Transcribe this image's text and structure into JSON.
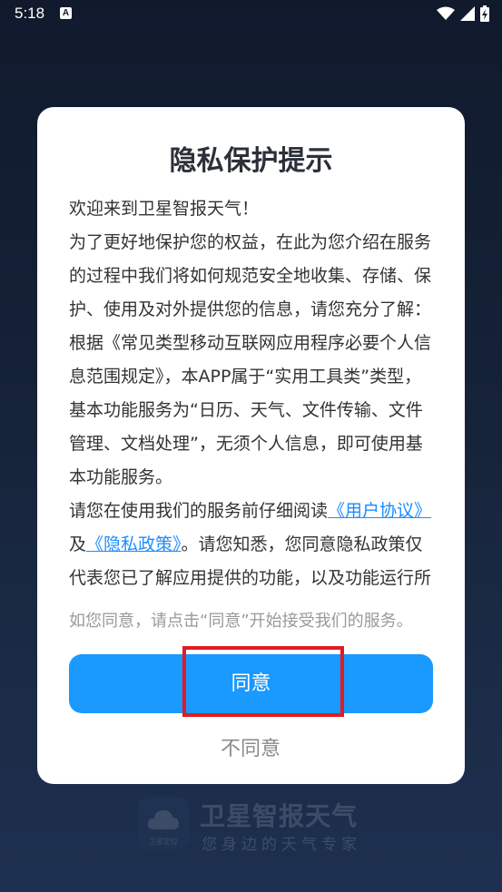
{
  "status_bar": {
    "time": "5:18",
    "notification_icon_letter": "A",
    "icons": [
      "wifi-icon",
      "signal-icon",
      "battery-charging-icon"
    ]
  },
  "dialog": {
    "title": "隐私保护提示",
    "paragraphs": {
      "p1": "欢迎来到卫星智报天气！",
      "p2": "为了更好地保护您的权益，在此为您介绍在服务的过程中我们将如何规范安全地收集、存储、保护、使用及对外提供您的信息，请您充分了解：根据《常见类型移动互联网应用程序必要个人信息范围规定》，本APP属于“实用工具类”类型，基本功能服务为“日历、天气、文件传输、文件管理、文档处理”，无须个人信息，即可使用基本功能服务。",
      "p3_before": "请您在使用我们的服务前仔细阅读",
      "user_agreement_link": "《用户协议》",
      "p3_and": "及",
      "privacy_policy_link": "《隐私政策》",
      "p3_after": "。请您知悉，您同意隐私政策仅代表您已了解应用提供的功能，以及功能运行所"
    },
    "hint": "如您同意，请点击“同意”开始接受我们的服务。",
    "agree_label": "同意",
    "disagree_label": "不同意"
  },
  "background_logo": {
    "app_name": "卫星智报天气",
    "slogan": "您身边的天气专家",
    "icon_caption": "卫星定位"
  },
  "colors": {
    "accent": "#1a99ff",
    "link": "#1a8cff",
    "highlight": "#e01b24",
    "background": "#142136"
  }
}
